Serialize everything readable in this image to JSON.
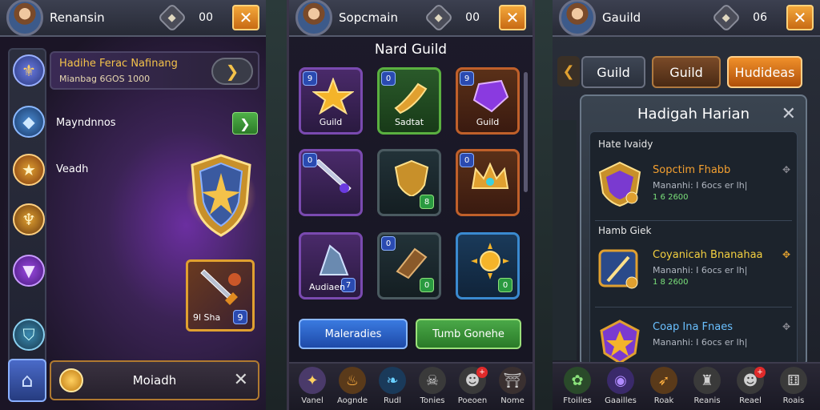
{
  "panel1": {
    "player_name": "Renansin",
    "count": "00",
    "quest": {
      "title": "Hadihe Ferac Nafinang",
      "subtitle": "Mianbag 6GOS 1000"
    },
    "rail_labels": {
      "first": "Mayndnnos",
      "second": "Veadh"
    },
    "item_card": {
      "label": "9l Sha",
      "number": "9"
    },
    "bottom_label": "Moiadh"
  },
  "panel2": {
    "player_name": "Sopcmain",
    "count": "00",
    "title": "Nard Guild",
    "tiles": [
      {
        "label": "Guild",
        "badge": "9",
        "count": ""
      },
      {
        "label": "Sadtat",
        "badge": "0",
        "count": ""
      },
      {
        "label": "Guild",
        "badge": "9",
        "count": ""
      },
      {
        "label": "",
        "badge": "0",
        "count": ""
      },
      {
        "label": "",
        "badge": "",
        "count": "8"
      },
      {
        "label": "",
        "badge": "0",
        "count": ""
      },
      {
        "label": "Audiaen",
        "badge": "",
        "count": "7"
      },
      {
        "label": "",
        "badge": "0",
        "count": "0"
      },
      {
        "label": "",
        "badge": "",
        "count": "0"
      }
    ],
    "btn_left": "Maleradies",
    "btn_right": "Tumb Gonehe",
    "nav": [
      {
        "label": "Vanel",
        "dot": ""
      },
      {
        "label": "Aognde",
        "dot": ""
      },
      {
        "label": "Rudl",
        "dot": ""
      },
      {
        "label": "Tonies",
        "dot": ""
      },
      {
        "label": "Poeoen",
        "dot": "+"
      },
      {
        "label": "Nome",
        "dot": ""
      }
    ]
  },
  "panel3": {
    "player_name": "Gauild",
    "count": "06",
    "tabs": [
      "Guild",
      "Guild",
      "Hudideas"
    ],
    "dialog_title": "Hadigah Harian",
    "section1": "Hate Ivaidy",
    "section2": "Hamb Giek",
    "entries": [
      {
        "name": "Sopctim Fhabb",
        "line2": "Mananhi: I 6ocs er lh|",
        "line3": "1 6 2600"
      },
      {
        "name": "Coyanicah Bnanahaa",
        "line2": "Mananhi: I 6ocs er lh|",
        "line3": "1 8 2600"
      },
      {
        "name": "Coap Ina Fnaes",
        "line2": "Mananhi: I 6ocs er lh|",
        "line3": ""
      }
    ],
    "nav": [
      {
        "label": "Ftoilies",
        "dot": ""
      },
      {
        "label": "Gaailles",
        "dot": ""
      },
      {
        "label": "Roak",
        "dot": ""
      },
      {
        "label": "Reanis",
        "dot": ""
      },
      {
        "label": "Reael",
        "dot": "+"
      },
      {
        "label": "Roais",
        "dot": ""
      }
    ]
  },
  "colors": {
    "accent_orange": "#f3a73a",
    "gold_text": "#f4c24a",
    "green": "#4aa848",
    "blue": "#3a7ae0"
  },
  "icons": [
    "gear-icon",
    "close-icon",
    "chevron-right-icon",
    "shield-icon",
    "coin-icon",
    "home-icon",
    "chevron-left-icon"
  ]
}
